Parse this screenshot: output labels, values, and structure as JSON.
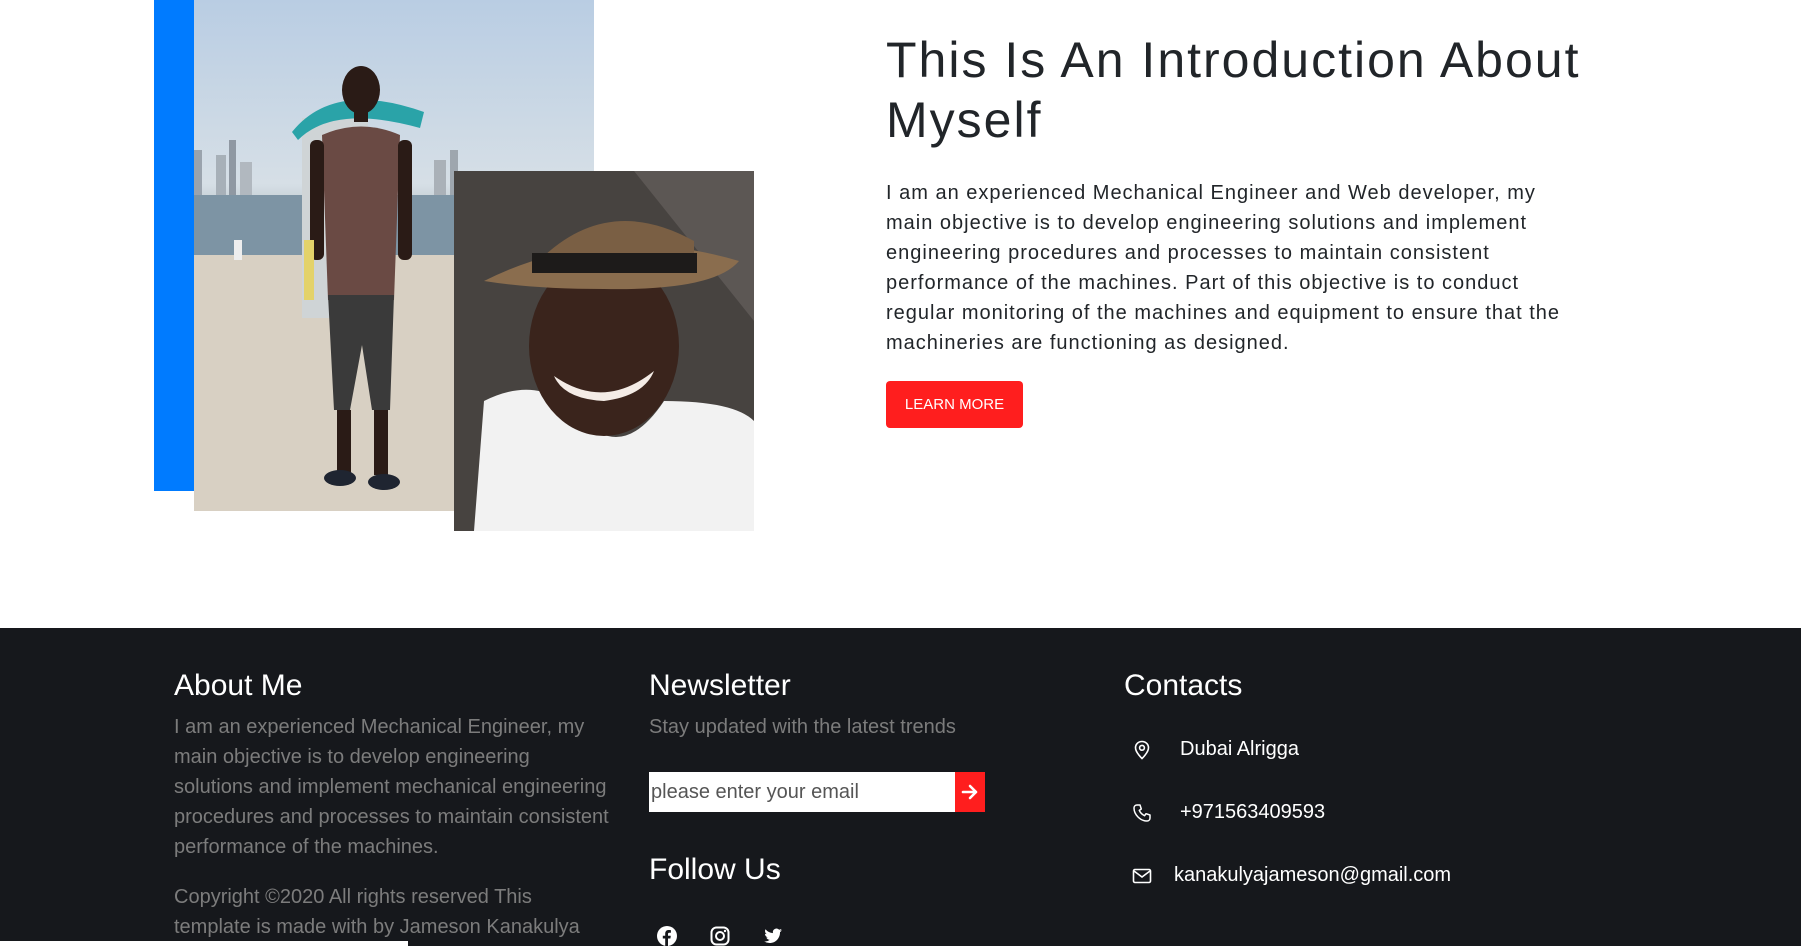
{
  "colors": {
    "accent_blue": "#007bff",
    "button_red": "#ff1e1e",
    "footer_bg": "#16181c",
    "white": "#ffffff"
  },
  "intro": {
    "title": "This Is An Introduction About Myself",
    "body": "I am an experienced Mechanical Engineer and Web developer, my main objective is to develop engineering solutions and implement engineering procedures and processes to maintain consistent performance of the machines. Part of this objective is to conduct regular monitoring of the machines and equipment to ensure that the machineries are functioning as designed.",
    "button_label": "LEARN MORE"
  },
  "footer": {
    "about": {
      "title": "About Me",
      "body": "I am an experienced Mechanical Engineer, my main objective is to develop engineering solutions and implement mechanical engineering procedures and processes to maintain consistent performance of the machines.",
      "copyright": "Copyright ©2020 All rights reserved This template is made with by Jameson Kanakulya"
    },
    "newsletter": {
      "title": "Newsletter",
      "subtitle": "Stay updated with the latest trends",
      "email_placeholder": "please enter your email",
      "submit_icon": "arrow-right-icon"
    },
    "follow": {
      "title": "Follow Us",
      "icons": [
        "facebook-icon",
        "instagram-icon",
        "twitter-icon"
      ]
    },
    "contacts": {
      "title": "Contacts",
      "location": "Dubai Alrigga",
      "phone": "+971563409593",
      "email": "kanakulyajameson@gmail.com"
    }
  }
}
